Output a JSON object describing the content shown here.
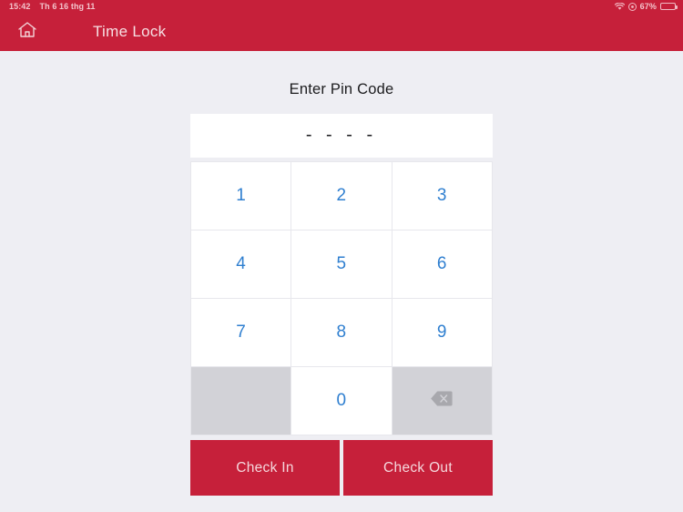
{
  "status_bar": {
    "time": "15:42",
    "date": "Th 6 16 thg 11",
    "battery_percent": "67%",
    "wifi_icon": "wifi-icon",
    "orientation_lock_icon": "rotation-lock-icon",
    "battery_icon": "battery-icon"
  },
  "nav_bar": {
    "title": "Time Lock",
    "home_icon": "home-icon",
    "background_color": "#c6203a"
  },
  "main": {
    "heading": "Enter Pin Code",
    "pin_display": {
      "value": "- - - -",
      "digit_count": 4,
      "entered_count": 0
    },
    "keypad": {
      "keys": [
        {
          "label": "1",
          "type": "digit"
        },
        {
          "label": "2",
          "type": "digit"
        },
        {
          "label": "3",
          "type": "digit"
        },
        {
          "label": "4",
          "type": "digit"
        },
        {
          "label": "5",
          "type": "digit"
        },
        {
          "label": "6",
          "type": "digit"
        },
        {
          "label": "7",
          "type": "digit"
        },
        {
          "label": "8",
          "type": "digit"
        },
        {
          "label": "9",
          "type": "digit"
        },
        {
          "label": "",
          "type": "blank"
        },
        {
          "label": "0",
          "type": "digit"
        },
        {
          "label": "",
          "type": "backspace",
          "icon": "backspace-icon"
        }
      ],
      "digit_color": "#2f7fd0",
      "key_background": "#ffffff",
      "disabled_background": "#d2d2d7"
    },
    "actions": {
      "check_in_label": "Check In",
      "check_out_label": "Check Out",
      "button_color": "#c6203a"
    }
  },
  "theme": {
    "accent": "#c6203a",
    "page_background": "#eeeef3",
    "blue": "#2f7fd0"
  }
}
